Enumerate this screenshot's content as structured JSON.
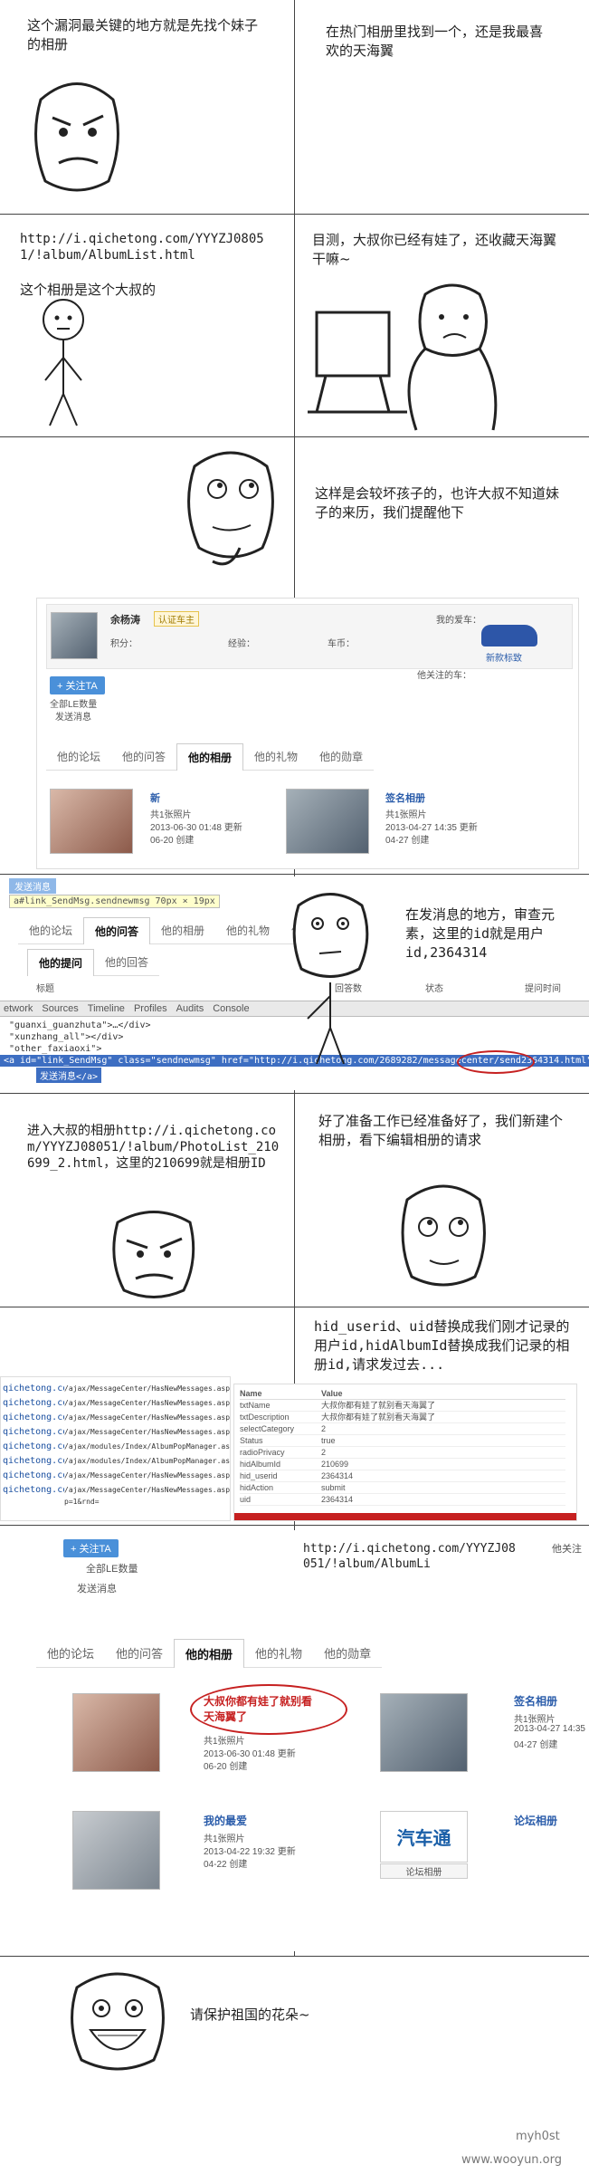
{
  "panels": {
    "p1_caption": "这个漏洞最关键的地方就是先找个妹子的相册",
    "p2_caption": "在热门相册里找到一个，还是我最喜欢的天海翼",
    "p3_url": "http://i.qichetong.com/YYYZJ08051/!album/AlbumList.html",
    "p3_caption": "这个相册是这个大叔的",
    "p4_caption": "目测，大叔你已经有娃了，还收藏天海翼干嘛~",
    "p5_caption": "这样是会较坏孩子的，也许大叔不知道妹子的来历，我们提醒他下",
    "p7_caption": "在发消息的地方，审查元素，这里的id就是用户id,2364314",
    "p8_caption": "进入大叔的相册http://i.qichetong.com/YYYZJ08051/!album/PhotoList_210699_2.html，这里的210699就是相册ID",
    "p9_caption": "好了准备工作已经准备好了，我们新建个相册，看下编辑相册的请求",
    "p10_caption": "hid_userid、uid替换成我们刚才记录的用户id,hidAlbumId替换成我们记录的相册id,请求发过去...",
    "p11_url": "http://i.qichetong.com/YYYZJ08051/!album/AlbumLi",
    "p13_caption": "请保护祖国的花朵~"
  },
  "profile": {
    "name": "余杨涛",
    "badge": "认证车主",
    "stats": [
      "积分：",
      "经验：",
      "车币："
    ],
    "car_label": "我的爱车：",
    "car_name": "新款标致",
    "follow_btn": "+ 关注TA",
    "msg": "发送消息",
    "stats_link": "全部LE数量",
    "fans_label": "他关注的车："
  },
  "tabs1": [
    "他的论坛",
    "他的问答",
    "他的相册",
    "他的礼物",
    "他的勋章"
  ],
  "albums1": [
    {
      "title": "新",
      "count": "共1张照片",
      "date": "2013-06-30 01:48 更新",
      "created": "06-20 创建"
    },
    {
      "title": "签名相册",
      "count": "共1张照片",
      "date": "2013-04-27 14:35 更新",
      "created": "04-27 创建"
    }
  ],
  "sendmsg": {
    "label": "发送消息",
    "tooltip": "a#link_SendMsg.sendnewmsg 70px × 19px"
  },
  "tabs2": [
    "他的论坛",
    "他的问答",
    "他的相册",
    "他的礼物",
    "他的勋章"
  ],
  "subtabs2": [
    "他的提问",
    "他的回答"
  ],
  "table2_headers": [
    "标题",
    "回答数",
    "状态",
    "提问时间"
  ],
  "devtools": {
    "tabs": [
      "etwork",
      "Sources",
      "Timeline",
      "Profiles",
      "Audits",
      "Console"
    ],
    "lines": [
      "\"guanxi_guanzhuta\">…</div>",
      "\"xunzhang_all\"></div>",
      "\"other_faxiaoxi\">"
    ],
    "selected": "<a id=\"link_SendMsg\" class=\"sendnewmsg\" href=\"http://i.qichetong.com/2689282/messagecenter/send2364314.html\">",
    "selected2": "发送消息</a>"
  },
  "reqtable": {
    "names": [
      "Name",
      "txtName",
      "txtDescription",
      "selectCategory",
      "Status",
      "radioPrivacy",
      "hidAlbumId",
      "hid_userid",
      "hidAction",
      "uid"
    ],
    "values": [
      "Value",
      "大叔你都有娃了就别看天海翼了",
      "大叔你都有娃了就别看天海翼了",
      "2",
      "true",
      "2",
      "210699",
      "2364314",
      "submit",
      "2364314"
    ],
    "urls": [
      "qichetong.com",
      "/ajax/MessageCenter/HasNewMessages.aspx?p=1&rnd=",
      "/ajax/modules/Index/AlbumPopManager.ashx"
    ]
  },
  "final": {
    "follow_btn": "+ 关注TA",
    "stats_link": "全部LE数量",
    "msg": "发送消息",
    "tabs": [
      "他的论坛",
      "他的问答",
      "他的相册",
      "他的礼物",
      "他的勋章"
    ],
    "albums": [
      {
        "title": "大叔你都有娃了就别看天海翼了",
        "count": "共1张照片",
        "date": "2013-06-30 01:48 更新",
        "created": "06-20 创建"
      },
      {
        "title": "签名相册",
        "count": "共1张照片",
        "date": "2013-04-27 14:35",
        "created": "04-27 创建"
      },
      {
        "title": "我的最爱",
        "count": "共1张照片",
        "date": "2013-04-22 19:32 更新",
        "created": "04-22 创建"
      },
      {
        "title": "论坛相册",
        "count": "",
        "date": "",
        "created": ""
      }
    ],
    "logo_text": "汽车通",
    "forum_album_btn": "论坛相册",
    "right_clip": "他关注"
  },
  "watermark": {
    "user": "myh0st",
    "site": "www.wooyun.org"
  }
}
